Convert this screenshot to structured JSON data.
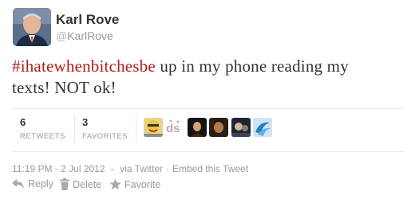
{
  "author": {
    "name": "Karl Rove",
    "screen_name": "KarlRove",
    "at_sign": "@"
  },
  "tweet": {
    "hashtag": "#ihatewhenbitchesbe",
    "text_line1_rest": " up in my phone reading my",
    "text_line2": "texts! NOT ok!"
  },
  "stats": {
    "retweets_count": "6",
    "retweets_label": "RETWEETS",
    "favorites_count": "3",
    "favorites_label": "FAVORITES"
  },
  "favoriter_avatars": [
    "avatar-yellow-cartoon",
    "avatar-ds-logo",
    "avatar-dark-figure",
    "avatar-dark-portrait",
    "avatar-dark-scene",
    "avatar-blue-swirl"
  ],
  "meta": {
    "time": "11:19 PM - 2 Jul 2012",
    "via": "via Twitter",
    "embed": "Embed this Tweet"
  },
  "actions": {
    "reply": "Reply",
    "delete": "Delete",
    "favorite": "Favorite"
  },
  "colors": {
    "hashtag": "#b11a1a",
    "muted": "#999999",
    "text": "#333333"
  }
}
